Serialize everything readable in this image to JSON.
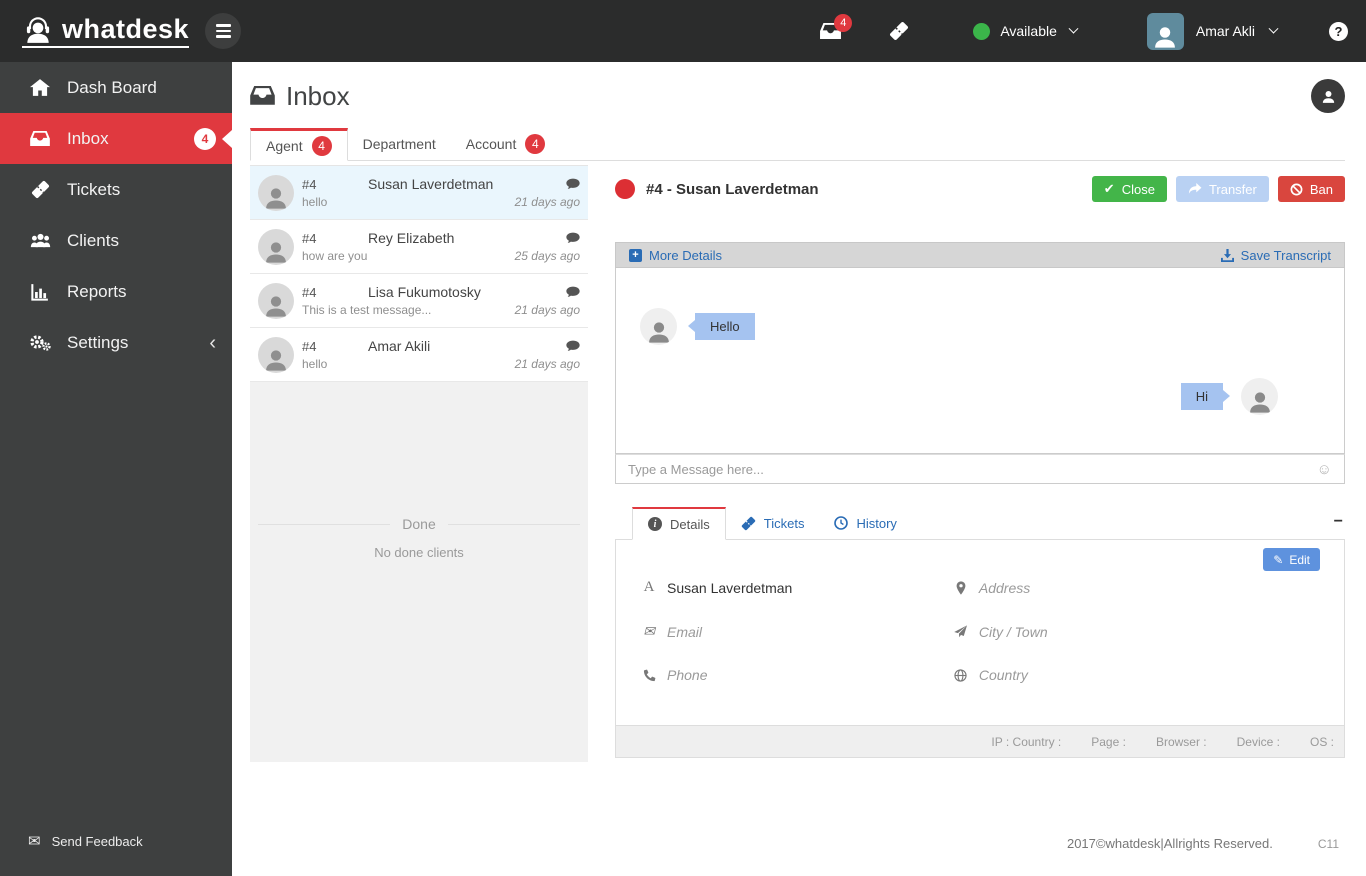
{
  "navbar": {
    "brand": "whatdesk",
    "inbox_badge": "4",
    "status": {
      "label": "Available"
    },
    "user": {
      "name": "Amar Akli"
    },
    "help_label": "?"
  },
  "sidebar": {
    "items": [
      {
        "label": "Dash Board",
        "icon": "home-icon"
      },
      {
        "label": "Inbox",
        "icon": "inbox-icon",
        "badge": "4",
        "active": true
      },
      {
        "label": "Tickets",
        "icon": "ticket-icon"
      },
      {
        "label": "Clients",
        "icon": "users-icon"
      },
      {
        "label": "Reports",
        "icon": "bar-chart-icon"
      },
      {
        "label": "Settings",
        "icon": "gears-icon",
        "chevron": "‹"
      }
    ],
    "feedback_label": "Send Feedback"
  },
  "page": {
    "title": "Inbox",
    "tabs": [
      {
        "label": "Agent",
        "badge": "4",
        "active": true
      },
      {
        "label": "Department"
      },
      {
        "label": "Account",
        "badge": "4"
      }
    ]
  },
  "chat_list": {
    "items": [
      {
        "id": "#4",
        "name": "Susan Laverdetman",
        "preview": "hello",
        "time": "21 days ago",
        "selected": true
      },
      {
        "id": "#4",
        "name": "Rey Elizabeth",
        "preview": "how are you",
        "time": "25 days ago",
        "selected": false
      },
      {
        "id": "#4",
        "name": "Lisa Fukumotosky",
        "preview": "This is a test message...",
        "time": "21 days ago",
        "selected": false
      },
      {
        "id": "#4",
        "name": "Amar Akili",
        "preview": "hello",
        "time": "21 days ago",
        "selected": false
      }
    ],
    "done_label": "Done",
    "done_empty_label": "No done clients"
  },
  "chat": {
    "title": "#4 - Susan Laverdetman",
    "close_label": "Close",
    "transfer_label": "Transfer",
    "ban_label": "Ban",
    "more_details_label": "More Details",
    "save_transcript_label": "Save Transcript",
    "messages": [
      {
        "text": "Hello",
        "side": "left"
      },
      {
        "text": "Hi",
        "side": "right"
      }
    ],
    "input_placeholder": "Type a Message here..."
  },
  "details": {
    "tabs": [
      {
        "label": "Details",
        "icon": "info-icon",
        "active": true
      },
      {
        "label": "Tickets",
        "icon": "ticket-icon",
        "active": false
      },
      {
        "label": "History",
        "icon": "clock-icon",
        "active": false
      }
    ],
    "collapse_label": "−",
    "edit_label": "Edit",
    "name_value": "Susan Laverdetman",
    "placeholders": {
      "email": "Email",
      "phone": "Phone",
      "address": "Address",
      "city": "City / Town",
      "country": "Country"
    },
    "meta": [
      "IP : Country :",
      "Page :",
      "Browser :",
      "Device :",
      "OS :"
    ]
  },
  "footer": {
    "copyright": "2017©whatdesk|Allrights Reserved.",
    "code": "C11"
  },
  "colors": {
    "accent_red": "#e0393f",
    "close_green": "#43b549",
    "status_green": "#3bb54a",
    "link_blue": "#2a6cb5",
    "transfer_blue": "#b9d1f3",
    "edit_blue": "#5e92de",
    "bubble_blue": "#a5c3f0",
    "navbar_bg": "#2b2c2c",
    "sidebar_bg": "#3e4040"
  }
}
